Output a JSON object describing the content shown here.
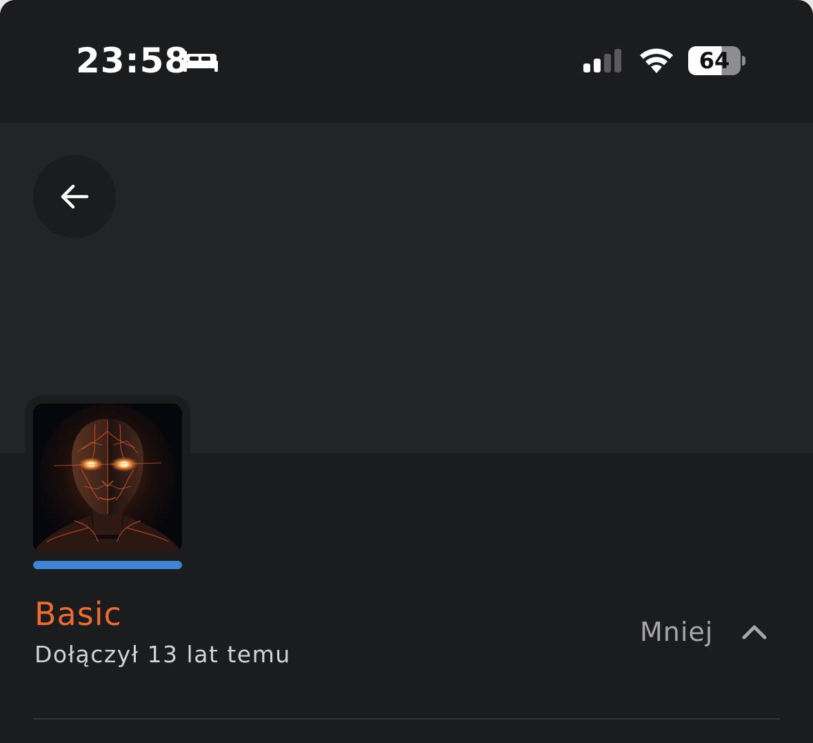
{
  "status_bar": {
    "time": "23:58",
    "focus_icon": "bed-icon",
    "signal_icon": "cellular-signal-icon",
    "wifi_icon": "wifi-icon",
    "battery_level": "64",
    "battery_fraction": 0.64
  },
  "header": {
    "back_icon": "arrow-left-icon"
  },
  "profile": {
    "avatar_icon": "glowing-head-avatar",
    "level_progress": 1.0,
    "rank": "Basic",
    "joined": "Dołączył 13 lat temu",
    "toggle_label": "Mniej",
    "toggle_icon": "chevron-up-icon"
  },
  "colors": {
    "background": "#1b1c1e",
    "banner": "#232426",
    "rank": "#ef6b2e",
    "progress": "#3d84d6",
    "secondary_text": "#a7a7aa"
  }
}
